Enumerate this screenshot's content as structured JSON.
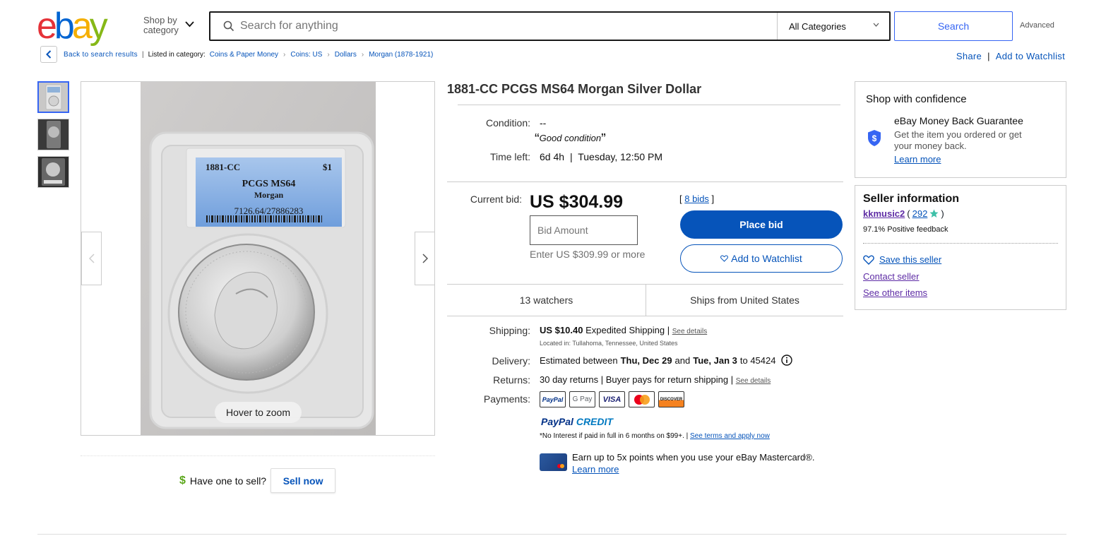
{
  "header": {
    "logo_letters": [
      "e",
      "b",
      "a",
      "y"
    ],
    "logo_colors": [
      "#e53238",
      "#0064d2",
      "#f5af02",
      "#86b817"
    ],
    "shop_by_line1": "Shop by",
    "shop_by_line2": "category",
    "search_placeholder": "Search for anything",
    "category_select": "All Categories",
    "search_button": "Search",
    "advanced_link": "Advanced"
  },
  "breadcrumb": {
    "back_text": "Back to search results",
    "listed_in": "Listed in category:",
    "items": [
      "Coins & Paper Money",
      "Coins: US",
      "Dollars",
      "Morgan (1878-1921)"
    ],
    "share": "Share",
    "add_watchlist": "Add to Watchlist"
  },
  "gallery": {
    "slab_line1_left": "1881-CC",
    "slab_line1_right": "$1",
    "slab_grade": "PCGS MS64",
    "slab_type": "Morgan",
    "slab_cert": "7126.64/27886283",
    "hover_zoom": "Hover to zoom",
    "sell_question": "Have one to sell?",
    "sell_button": "Sell now"
  },
  "item": {
    "title": "1881-CC PCGS MS64 Morgan Silver Dollar",
    "condition_label": "Condition:",
    "condition_value": "--",
    "condition_quote": "Good condition",
    "time_left_label": "Time left:",
    "time_left_value": "6d 4h",
    "time_left_end": "Tuesday, 12:50 PM",
    "current_bid_label": "Current bid:",
    "current_bid_value": "US $304.99",
    "bid_amount_placeholder": "Bid Amount",
    "enter_min": "Enter US $309.99 or more",
    "bids_count": "8 bids",
    "place_bid": "Place bid",
    "add_to_watchlist": "Add to Watchlist",
    "watchers": "13 watchers",
    "ships_from": "Ships from United States",
    "shipping_label": "Shipping:",
    "shipping_price": "US $10.40",
    "shipping_method": "Expedited Shipping",
    "see_details": "See details",
    "located_in": "Located in: Tullahoma, Tennessee, United States",
    "delivery_label": "Delivery:",
    "delivery_prefix": "Estimated between",
    "delivery_start": "Thu, Dec 29",
    "delivery_and": "and",
    "delivery_end": "Tue, Jan 3",
    "delivery_zip": "to 45424",
    "returns_label": "Returns:",
    "returns_value": "30 day returns | Buyer pays for return shipping |",
    "returns_see_details": "See details",
    "payments_label": "Payments:",
    "payment_methods": [
      "PayPal",
      "G Pay",
      "VISA",
      "Mastercard",
      "DISCOVER"
    ],
    "paypal_credit_a": "PayPal",
    "paypal_credit_b": "CREDIT",
    "interest_note": "*No Interest if paid in full in 6 months on $99+. |",
    "interest_link": "See terms and apply now",
    "mastercard_text": "Earn up to 5x points when you use your eBay Mastercard®.",
    "mastercard_link": "Learn more"
  },
  "sidebar": {
    "confidence_title": "Shop with confidence",
    "guarantee_title": "eBay Money Back Guarantee",
    "guarantee_text_1": "Get the item you ordered or get",
    "guarantee_text_2": "your money back.",
    "guarantee_link": "Learn more",
    "seller_title": "Seller information",
    "seller_name": "kkmusic2",
    "seller_score": "292",
    "positive_feedback": "97.1% Positive feedback",
    "save_seller": "Save this seller",
    "contact_seller": "Contact seller",
    "see_other_items": "See other items"
  },
  "colors": {
    "link_blue": "#0654ba",
    "search_blue": "#3665f3",
    "seller_purple": "#5e2ca5",
    "guarantee_badge": "#3665f3"
  }
}
